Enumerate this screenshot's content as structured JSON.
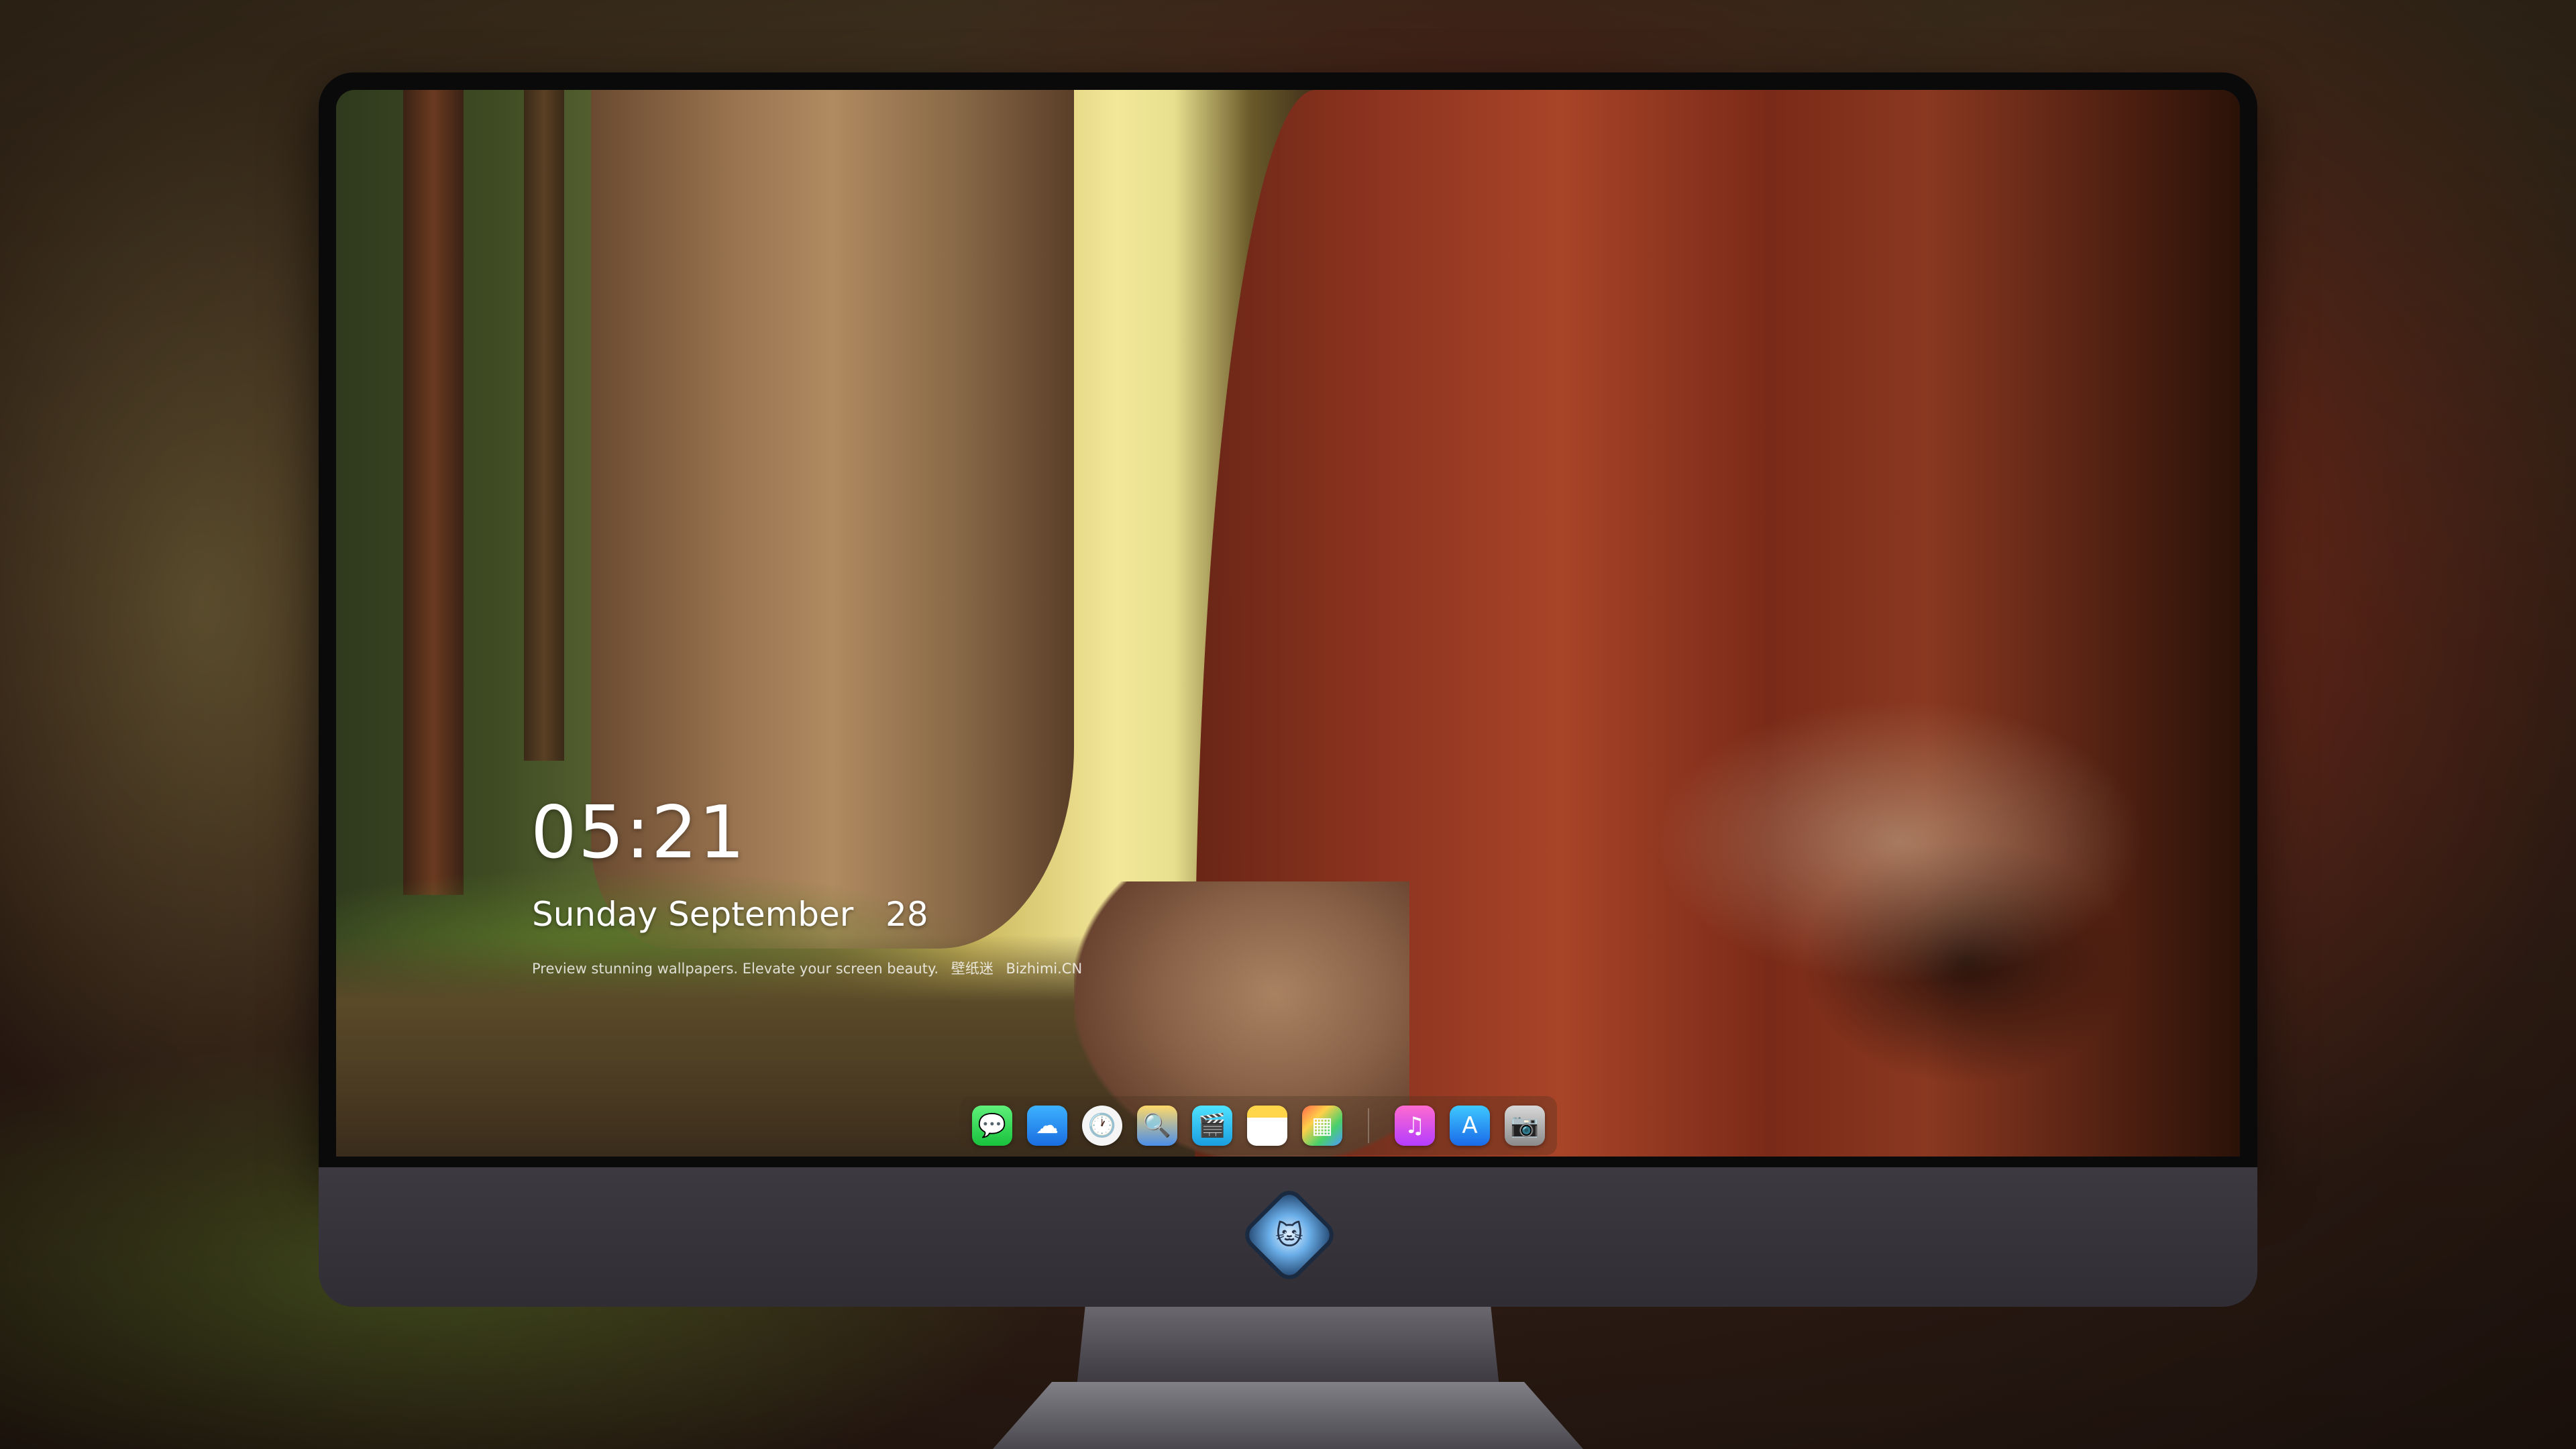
{
  "lock_screen": {
    "time": "05:21",
    "date": "Sunday September   28",
    "tagline": {
      "text": "Preview stunning wallpapers. Elevate your screen beauty.",
      "brand_cn": "壁纸迷",
      "site": "Bizhimi.CN"
    }
  },
  "dock": {
    "apps": [
      {
        "name": "messages",
        "glyph": "💬"
      },
      {
        "name": "weather",
        "glyph": "☁"
      },
      {
        "name": "clock",
        "glyph": "🕐"
      },
      {
        "name": "preview",
        "glyph": "🔍"
      },
      {
        "name": "claquette",
        "glyph": "🎬"
      },
      {
        "name": "notes",
        "glyph": ""
      },
      {
        "name": "photos",
        "glyph": "▦"
      },
      {
        "name": "music",
        "glyph": "♫"
      },
      {
        "name": "app-store",
        "glyph": "A"
      },
      {
        "name": "camera",
        "glyph": "📷"
      }
    ]
  },
  "monitor": {
    "logo_glyph": "🐱"
  }
}
